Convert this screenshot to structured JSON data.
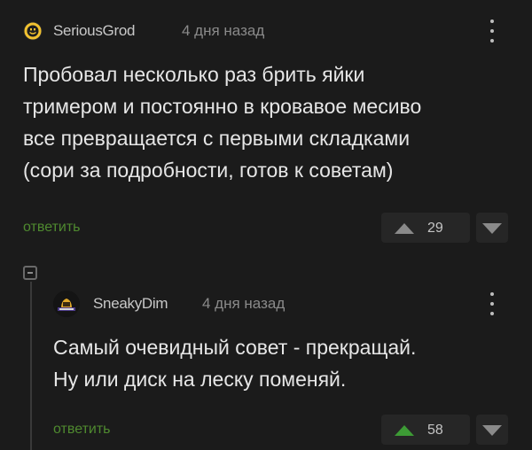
{
  "comments": [
    {
      "username": "SeriousGrod",
      "time": "4 дня назад",
      "text_lines": [
        "Пробовал несколько раз брить яйки",
        "тримером и постоянно в кровавое месиво",
        "все превращается с первыми складками",
        "(сори за подробности, готов к советам)"
      ],
      "reply_label": "ответить",
      "rating": "29",
      "upvote_color": "#8a8a8a"
    },
    {
      "username": "SneakyDim",
      "time": "4 дня назад",
      "text_lines": [
        "Самый очевидный совет - прекращай.",
        "Ну или диск на леску поменяй."
      ],
      "reply_label": "ответить",
      "rating": "58",
      "upvote_color": "#3d9b35"
    }
  ],
  "colors": {
    "background": "#1b1b1b",
    "text": "#e6e6e6",
    "meta": "#8a8a8a",
    "reply_link": "#4f8a2f",
    "upvoted": "#3d9b35"
  }
}
